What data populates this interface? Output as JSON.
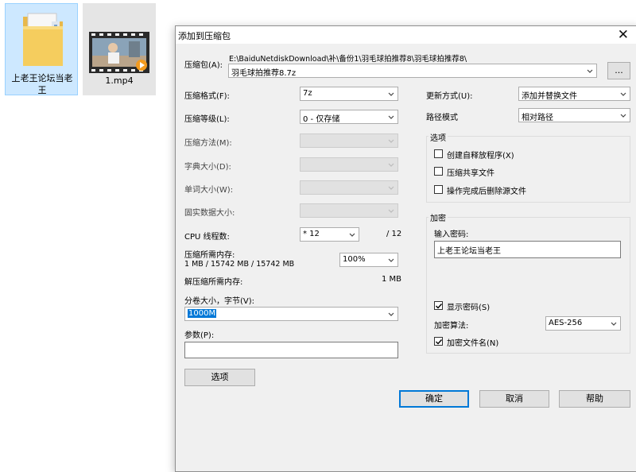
{
  "desktop": {
    "folder_label": "上老王论坛当老王",
    "video_label": "1.mp4"
  },
  "dialog": {
    "title": "添加到压缩包",
    "close_glyph": "✕",
    "archive_label": "压缩包(A):",
    "archive_path": "E:\\BaiduNetdiskDownload\\补\\备份1\\羽毛球拍推荐8\\羽毛球拍推荐8\\",
    "archive_name": "羽毛球拍推荐8.7z",
    "browse_label": "...",
    "format_label": "压缩格式(F):",
    "format_value": "7z",
    "level_label": "压缩等级(L):",
    "level_value": "0 - 仅存储",
    "method_label": "压缩方法(M):",
    "dict_label": "字典大小(D):",
    "word_label": "单词大小(W):",
    "solid_label": "固实数据大小:",
    "cpu_label": "CPU 线程数:",
    "cpu_value": "* 12",
    "cpu_total": "/ 12",
    "mem_comp_label": "压缩所需内存:",
    "mem_comp_detail": "1 MB / 15742 MB / 15742 MB",
    "mem_percent": "100%",
    "mem_decomp_label": "解压缩所需内存:",
    "mem_decomp_value": "1 MB",
    "split_label": "分卷大小，字节(V):",
    "split_value": "1000M",
    "params_label": "参数(P):",
    "params_value": "",
    "options_button": "选项",
    "update_label": "更新方式(U):",
    "update_value": "添加并替换文件",
    "path_label": "路径模式",
    "path_value": "相对路径",
    "options_group": "选项",
    "opt_sfx": "创建自释放程序(X)",
    "opt_shared": "压缩共享文件",
    "opt_delete": "操作完成后删除源文件",
    "encrypt_group": "加密",
    "password_label": "输入密码:",
    "password_value": "上老王论坛当老王",
    "show_password": "显示密码(S)",
    "enc_method_label": "加密算法:",
    "enc_method_value": "AES-256",
    "encrypt_names": "加密文件名(N)",
    "ok_button": "确定",
    "cancel_button": "取消",
    "help_button": "帮助",
    "checkbox_states": {
      "sfx": false,
      "shared": false,
      "delete": false,
      "show_password": true,
      "encrypt_names": true
    }
  }
}
